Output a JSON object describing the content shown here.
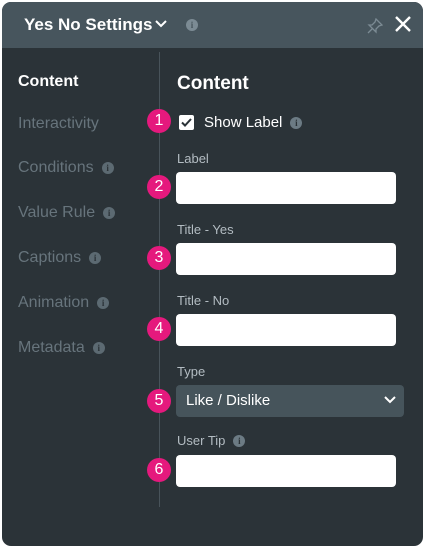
{
  "header": {
    "title": "Yes No Settings",
    "icons": [
      "chevron-down-icon",
      "info-icon",
      "pin-icon",
      "close-icon"
    ]
  },
  "sidebar": {
    "items": [
      {
        "label": "Content",
        "active": true,
        "info": false
      },
      {
        "label": "Interactivity",
        "active": false,
        "info": false
      },
      {
        "label": "Conditions",
        "active": false,
        "info": true
      },
      {
        "label": "Value Rule",
        "active": false,
        "info": true
      },
      {
        "label": "Captions",
        "active": false,
        "info": true
      },
      {
        "label": "Animation",
        "active": false,
        "info": true
      },
      {
        "label": "Metadata",
        "active": false,
        "info": true
      }
    ]
  },
  "main": {
    "title": "Content",
    "show_label": {
      "label": "Show Label",
      "checked": true
    },
    "fields": {
      "label": {
        "label": "Label",
        "value": ""
      },
      "title_yes": {
        "label": "Title - Yes",
        "value": ""
      },
      "title_no": {
        "label": "Title - No",
        "value": ""
      },
      "type": {
        "label": "Type",
        "value": "Like / Dislike"
      },
      "user_tip": {
        "label": "User Tip",
        "value": ""
      }
    },
    "badges": [
      "1",
      "2",
      "3",
      "4",
      "5",
      "6"
    ]
  },
  "colors": {
    "panel": "#2b3338",
    "header": "#47555d",
    "badge": "#e5197d",
    "select": "#46545b"
  }
}
